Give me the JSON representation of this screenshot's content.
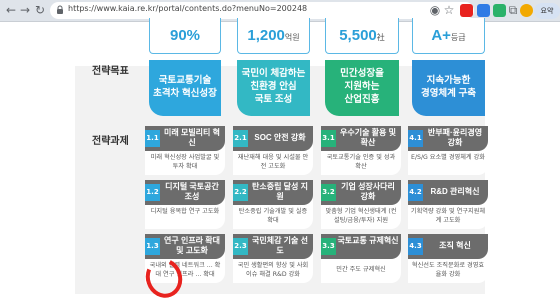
{
  "browser": {
    "url": "https://www.kaia.re.kr/portal/contents.do?menuNo=200248",
    "profile_label": "요약"
  },
  "stats": [
    {
      "label": "",
      "value": "90%",
      "unit": ""
    },
    {
      "label": "",
      "value": "1,200",
      "unit": "억원"
    },
    {
      "label": "",
      "value": "5,500",
      "unit": "社"
    },
    {
      "label": "",
      "value": "A+",
      "unit": "등급"
    }
  ],
  "rows": {
    "goal_label": "전략목표",
    "task_label": "전략과제"
  },
  "goals": [
    {
      "lines": [
        "국토교통기술",
        "초격차 혁신성장"
      ],
      "color": "#2ea7dd"
    },
    {
      "lines": [
        "국민이 체감하는",
        "친환경 안심",
        "국토 조성"
      ],
      "color": "#33b8c4"
    },
    {
      "lines": [
        "민간성장을",
        "지원하는",
        "산업진흥"
      ],
      "color": "#27b27a"
    },
    {
      "lines": [
        "지속가능한",
        "경영체계 구축"
      ],
      "color": "#2d8fd6"
    }
  ],
  "tasks": [
    [
      {
        "num": "1.1",
        "title": "미래 모빌리티 혁신",
        "desc": "미래 혁신성장 사업발굴 및 투자 확대",
        "color": "#2ea7dd"
      },
      {
        "num": "1.2",
        "title": "디지털 국토공간 조성",
        "desc": "디지털 융복합 연구 고도화",
        "color": "#2ea7dd"
      },
      {
        "num": "1.3",
        "title": "연구 인프라 확대 및 고도화",
        "desc": "국내외 협력 네트워크 ... 확대 연구 인프라 ... 확대",
        "color": "#2ea7dd"
      }
    ],
    [
      {
        "num": "2.1",
        "title": "SOC 안전 강화",
        "desc": "재난재해 대응 및 시설물 안전 고도화",
        "color": "#33b8c4"
      },
      {
        "num": "2.2",
        "title": "탄소중립 달성 지원",
        "desc": "탄소중립 기술개발 및 실증 확대",
        "color": "#33b8c4"
      },
      {
        "num": "2.3",
        "title": "국민체감 기술 선도",
        "desc": "국민 생활편의 향상 및 사회이슈 해결 R&D 강화",
        "color": "#33b8c4"
      }
    ],
    [
      {
        "num": "3.1",
        "title": "우수기술 활용 및 확산",
        "desc": "국토교통기술 인증 및 성과 확산",
        "color": "#27b27a"
      },
      {
        "num": "3.2",
        "title": "기업 성장사다리 강화",
        "desc": "맞춤형 기업 혁신생태계 (컨설팅/금융/투자) 지원",
        "color": "#27b27a"
      },
      {
        "num": "3.3",
        "title": "국토교통 규제혁신",
        "desc": "민간 주도 규제혁신",
        "color": "#27b27a"
      }
    ],
    [
      {
        "num": "4.1",
        "title": "반부패·윤리경영 강화",
        "desc": "E/S/G 요소별 경영체계 강화",
        "color": "#2d8fd6"
      },
      {
        "num": "4.2",
        "title": "R&D 관리혁신",
        "desc": "기획역량 강화 및 연구지원체계 고도화",
        "color": "#2d8fd6"
      },
      {
        "num": "4.3",
        "title": "조직 혁신",
        "desc": "혁신선도 조직문화로 경영효율화 강화",
        "color": "#2d8fd6"
      }
    ]
  ]
}
